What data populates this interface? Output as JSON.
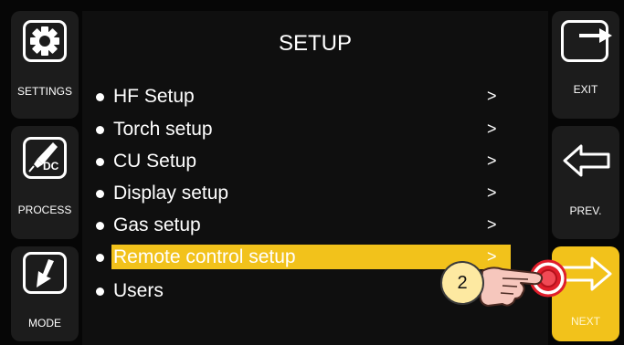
{
  "screen_title": "SETUP",
  "left_buttons": [
    {
      "label": "SETTINGS",
      "icon": "gear-icon"
    },
    {
      "label": "PROCESS",
      "icon": "torch-icon",
      "icon_text": "DC"
    },
    {
      "label": "MODE",
      "icon": "down-arrow-icon"
    }
  ],
  "right_buttons": [
    {
      "label": "EXIT",
      "icon": "exit-arrow-icon"
    },
    {
      "label": "PREV.",
      "icon": "left-arrow-icon"
    },
    {
      "label": "NEXT",
      "icon": "right-arrow-icon"
    }
  ],
  "menu_items": [
    {
      "label": "HF Setup",
      "arrow": ">"
    },
    {
      "label": "Torch setup",
      "arrow": ">"
    },
    {
      "label": "CU Setup",
      "arrow": ">"
    },
    {
      "label": "Display setup",
      "arrow": ">"
    },
    {
      "label": "Gas setup",
      "arrow": ">"
    },
    {
      "label": "Remote control setup",
      "arrow": ">",
      "selected": true
    },
    {
      "label": "Users",
      "arrow": ""
    }
  ],
  "step_badge": "2",
  "colors": {
    "background": "#060606",
    "panel": "#0f0f0f",
    "side_button": "#1c1c1c",
    "highlight": "#f2c21b",
    "next_button": "#f2c21b",
    "press_red": "#e01e2b"
  }
}
